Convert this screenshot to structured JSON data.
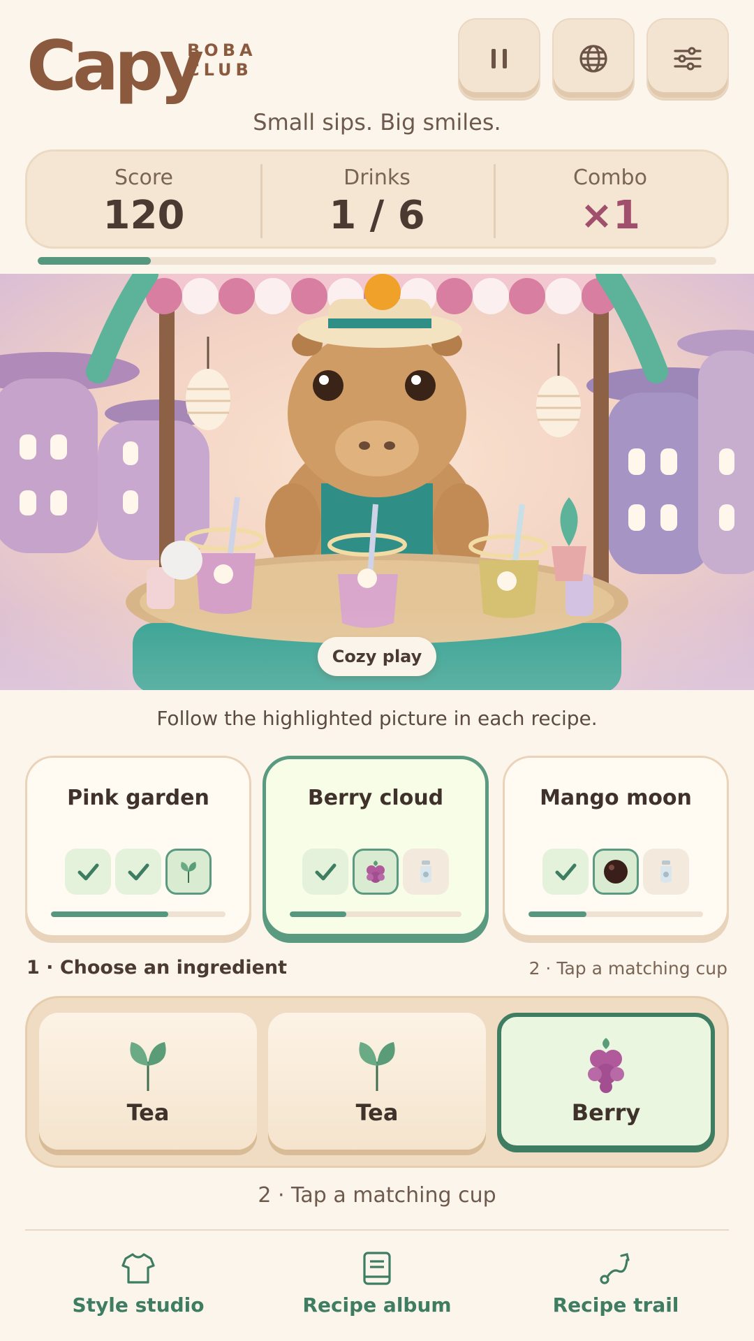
{
  "header": {
    "logo_main": "Capy",
    "logo_sub_1": "BOBA",
    "logo_sub_2": "CLUB",
    "tagline": "Small sips. Big smiles.",
    "buttons": [
      {
        "icon": "pause-icon"
      },
      {
        "icon": "globe-icon"
      },
      {
        "icon": "sliders-icon"
      }
    ]
  },
  "stats": {
    "score_label": "Score",
    "score_value": "120",
    "drinks_label": "Drinks",
    "drinks_value": "1 / 6",
    "combo_label": "Combo",
    "combo_value": "×1",
    "progress": 0.167
  },
  "scene": {
    "badge": "Cozy play",
    "instruction": "Follow the highlighted picture in each recipe."
  },
  "recipes": [
    {
      "title": "Pink garden",
      "progress": 0.67,
      "slots": [
        "done",
        "done",
        "tea-current"
      ]
    },
    {
      "title": "Berry cloud",
      "progress": 0.33,
      "active": true,
      "slots": [
        "done",
        "berry-current",
        "milk-empty"
      ]
    },
    {
      "title": "Mango moon",
      "progress": 0.33,
      "slots": [
        "done",
        "pearl-current",
        "milk-empty"
      ]
    }
  ],
  "chooser": {
    "step1": "1 · Choose an ingredient",
    "step2_hint": "2 · Tap a matching cup",
    "ingredients": [
      {
        "label": "Tea",
        "icon": "tea-leaf-icon"
      },
      {
        "label": "Tea",
        "icon": "tea-leaf-icon"
      },
      {
        "label": "Berry",
        "icon": "berry-icon",
        "selected": true
      }
    ],
    "step2": "2 · Tap a matching cup"
  },
  "nav": {
    "items": [
      {
        "label": "Style studio",
        "icon": "shirt-icon"
      },
      {
        "label": "Recipe album",
        "icon": "book-icon"
      },
      {
        "label": "Recipe trail",
        "icon": "trail-icon"
      }
    ]
  },
  "colors": {
    "accent": "#3f7d63",
    "brand": "#8b5a3e",
    "combo": "#a0506c",
    "background": "#fcf5ec"
  }
}
